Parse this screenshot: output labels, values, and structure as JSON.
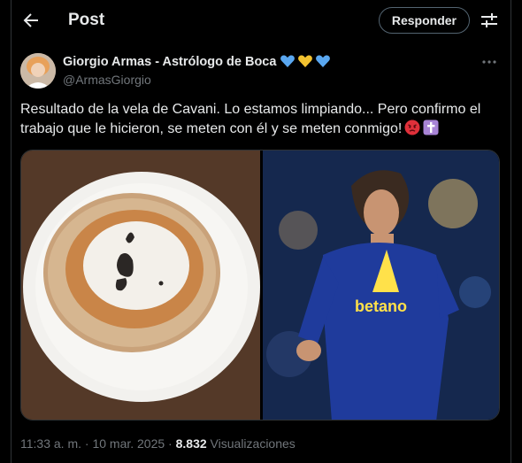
{
  "header": {
    "title": "Post",
    "reply_label": "Responder"
  },
  "post": {
    "author_name": "Giorgio Armas - Astrólogo de Boca",
    "handle": "@ArmasGiorgio",
    "text": "Resultado de la vela de Cavani. Lo estamos limpiando... Pero confirmo el trabajo que le hicieron, se meten con él y se meten conmigo!",
    "timestamp": "11:33 a. m. · 10 mar. 2025 · ",
    "views_count": "8.832",
    "views_label": " Visualizaciones",
    "jersey_text": "betano"
  },
  "colors": {
    "background": "#000000",
    "text": "#e7e9ea",
    "muted": "#71767b",
    "border": "#2f3336",
    "heart_blue": "#5aa7f0",
    "heart_yellow": "#f2c230"
  },
  "icons": [
    "back-arrow-icon",
    "tune-icon",
    "more-icon",
    "blue-heart-icon",
    "yellow-heart-icon",
    "angry-face-icon",
    "latin-cross-icon"
  ]
}
